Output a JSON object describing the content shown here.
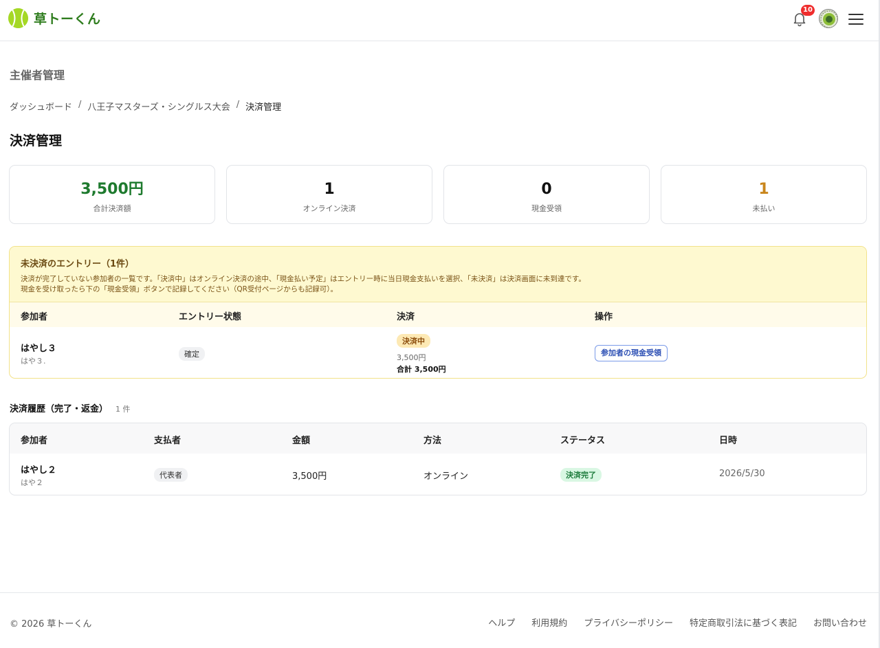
{
  "header": {
    "brand": "草トーくん",
    "notification_count": "10",
    "colors": {
      "brand_green": "#2f7d1e",
      "ball": "#9bd21e",
      "badge_red": "#ef2d2d"
    }
  },
  "section_title": "主催者管理",
  "breadcrumb": {
    "items": [
      "ダッシュボード",
      "八王子マスターズ・シングルス大会",
      "決済管理"
    ],
    "separator": "/"
  },
  "page_title": "決済管理",
  "stats": [
    {
      "value": "3,500円",
      "label": "合計決済額",
      "color": "#1e7a2e"
    },
    {
      "value": "1",
      "label": "オンライン決済",
      "color": "#111111"
    },
    {
      "value": "0",
      "label": "現金受領",
      "color": "#111111"
    },
    {
      "value": "1",
      "label": "未払い",
      "color": "#c9861c"
    }
  ],
  "unpaid": {
    "title": "未決済のエントリー（1件）",
    "desc_line1": "決済が完了していない参加者の一覧です。「決済中」はオンライン決済の途中、「現金払い予定」はエントリー時に当日現金支払いを選択、「未決済」は決済画面に未到達です。",
    "desc_line2": "現金を受け取ったら下の「現金受領」ボタンで記録してください（QR受付ページからも記録可）。",
    "columns": [
      "参加者",
      "エントリー状態",
      "決済",
      "操作"
    ],
    "rows": [
      {
        "name": "はやし３",
        "sub": "はや３.",
        "entry_status": "確定",
        "payment_status": "決済中",
        "amount": "3,500円",
        "total": "合計 3,500円",
        "action": "参加者の現金受領"
      }
    ]
  },
  "history": {
    "title": "決済履歴（完了・返金）",
    "count": "1 件",
    "columns": [
      "参加者",
      "支払者",
      "金額",
      "方法",
      "ステータス",
      "日時"
    ],
    "rows": [
      {
        "name": "はやし２",
        "sub": "はや２",
        "payer": "代表者",
        "amount": "3,500円",
        "method": "オンライン",
        "status": "決済完了",
        "date": "2026/5/30"
      }
    ]
  },
  "footer": {
    "copyright": "© 2026 草トーくん",
    "links": [
      "ヘルプ",
      "利用規約",
      "プライバシーポリシー",
      "特定商取引法に基づく表記",
      "お問い合わせ"
    ]
  }
}
